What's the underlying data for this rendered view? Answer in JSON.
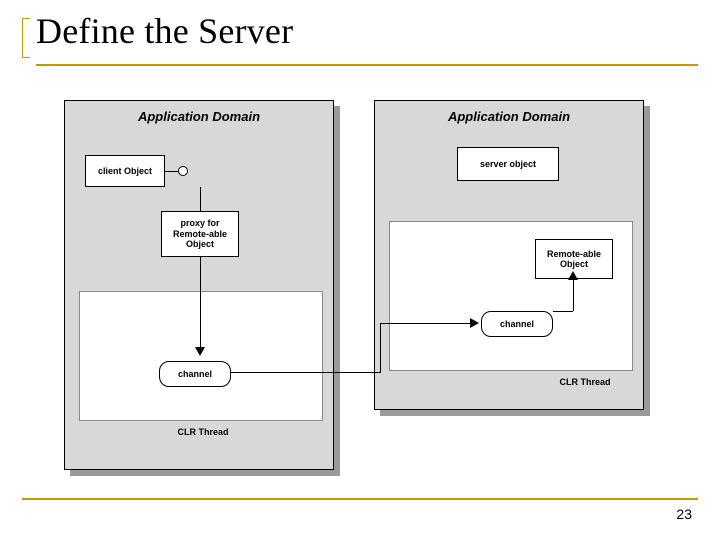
{
  "slide": {
    "title": "Define the Server",
    "page_number": "23"
  },
  "diagram": {
    "left_panel": {
      "title": "Application Domain",
      "client_object": "client Object",
      "proxy": "proxy for\nRemote-able\nObject",
      "channel": "channel",
      "thread_label": "CLR Thread"
    },
    "right_panel": {
      "title": "Application Domain",
      "server_object": "server object",
      "remoteable": "Remote-able\nObject",
      "channel": "channel",
      "thread_label": "CLR Thread"
    }
  }
}
